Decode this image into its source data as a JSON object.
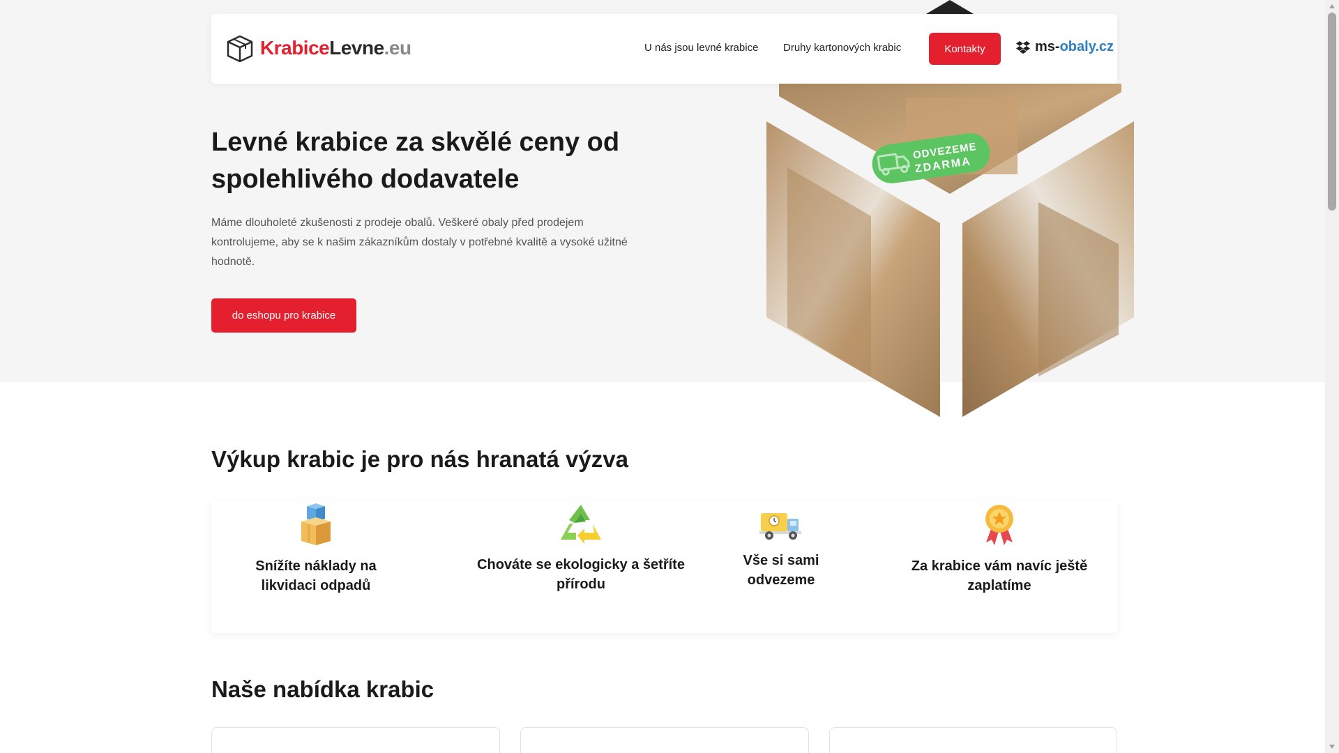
{
  "nav": {
    "logo_part1": "Krabice",
    "logo_part2": "Levne",
    "logo_part3": ".eu",
    "items": [
      {
        "label": "U nás jsou levné krabice"
      },
      {
        "label": "Druhy kartonových krabic"
      }
    ],
    "contact_label": "Kontakty",
    "partner_part1": "ms-",
    "partner_part2": "obaly.cz"
  },
  "hero": {
    "title": "Levné krabice za skvělé ceny od spolehlivého dodavatele",
    "description": "Máme dlouholeté zkušenosti z prodeje obalů. Veškeré obaly před prodejem kontrolujeme, aby se k našim zákazníkům dostaly v potřebné kvalitě a vysoké užitné hodnotě.",
    "button_label": "do eshopu pro krabice",
    "badge_line1": "ODVEZEME",
    "badge_line2": "ZDARMA"
  },
  "benefits": {
    "title": "Výkup krabic je pro nás hranatá výzva",
    "items": [
      {
        "icon": "boxes-icon",
        "label": "Snížíte náklady na likvidaci odpadů"
      },
      {
        "icon": "recycle-icon",
        "label": "Chováte se ekologicky a šetříte přírodu"
      },
      {
        "icon": "truck-icon",
        "label": "Vše si sami odvezeme"
      },
      {
        "icon": "award-medal-icon",
        "label": "Za krabice vám navíc ještě zaplatíme"
      }
    ]
  },
  "offer": {
    "title": "Naše nabídka krabic"
  },
  "colors": {
    "accent": "#e4202e",
    "hero_bg": "#f5f5f5",
    "badge": "#5cc561",
    "partner": "#2a7fc1"
  }
}
